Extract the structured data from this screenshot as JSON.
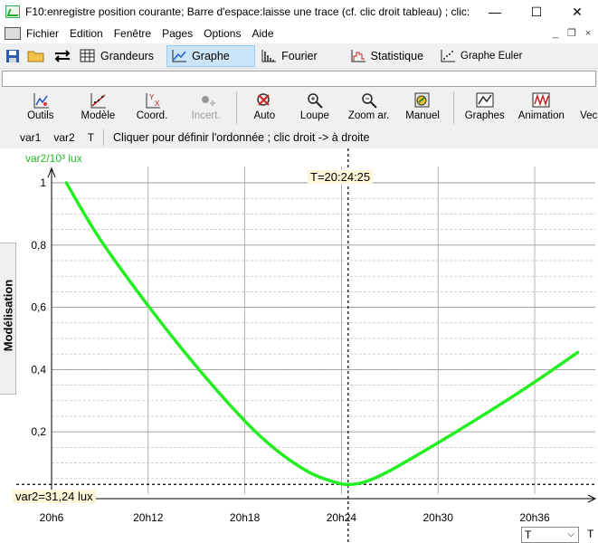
{
  "window": {
    "title": "F10:enregistre position courante; Barre d'espace:laisse une trace (cf. clic droit tableau) ; clic:",
    "min": "—",
    "max": "☐",
    "close": "✕"
  },
  "menu": {
    "items": [
      "Fichier",
      "Edition",
      "Fenêtre",
      "Pages",
      "Options",
      "Aide"
    ]
  },
  "tabs": {
    "grandeurs": "Grandeurs",
    "graphe": "Graphe",
    "fourier": "Fourier",
    "statistique": "Statistique",
    "euler": "Graphe Euler"
  },
  "tools": {
    "outils": "Outils",
    "modele": "Modèle",
    "coord": "Coord.",
    "incert": "Incert.",
    "auto": "Auto",
    "loupe": "Loupe",
    "zoom": "Zoom ar.",
    "manuel": "Manuel",
    "graphes": "Graphes",
    "animation": "Animation",
    "vec": "Vec"
  },
  "varbar": {
    "var1": "var1",
    "var2": "var2",
    "t": "T",
    "message": "Cliquer pour définir l'ordonnée ; clic droit -> à droite"
  },
  "sidetab": {
    "label": "Modélisation"
  },
  "readouts": {
    "t": "T=20:24:25",
    "y": "var2=31,24 lux"
  },
  "select": {
    "value": "T"
  },
  "colors": {
    "curve": "#22ee22",
    "ylabel": "#22bb22",
    "readout_bg": "#fdf6d8"
  },
  "chart_data": {
    "type": "line",
    "ylabel": "var2/10³ lux",
    "xlabel": "T",
    "ylim": [
      0,
      1.05
    ],
    "xlim_minutes": [
      0,
      35
    ],
    "x_ticks": [
      "20h6",
      "20h12",
      "20h18",
      "20h24",
      "20h30",
      "20h36"
    ],
    "y_ticks": [
      "1",
      "0,8",
      "0,6",
      "0,4",
      "0,2"
    ],
    "y_tick_values": [
      1,
      0.8,
      0.6,
      0.4,
      0.2
    ],
    "cursor": {
      "t": "20:24:25",
      "y": 0.03124
    },
    "series": [
      {
        "x": [
          "20:06:55",
          "20:09:00",
          "20:12:00",
          "20:15:00",
          "20:18:00",
          "20:20:00",
          "20:22:00",
          "20:23:30",
          "20:24:25",
          "20:25:30",
          "20:27:00",
          "20:30:00",
          "20:33:00",
          "20:36:00",
          "20:38:40"
        ],
        "y": [
          1.0,
          0.82,
          0.605,
          0.41,
          0.235,
          0.14,
          0.07,
          0.04,
          0.031,
          0.04,
          0.075,
          0.165,
          0.26,
          0.36,
          0.455
        ]
      }
    ],
    "grid": true
  }
}
